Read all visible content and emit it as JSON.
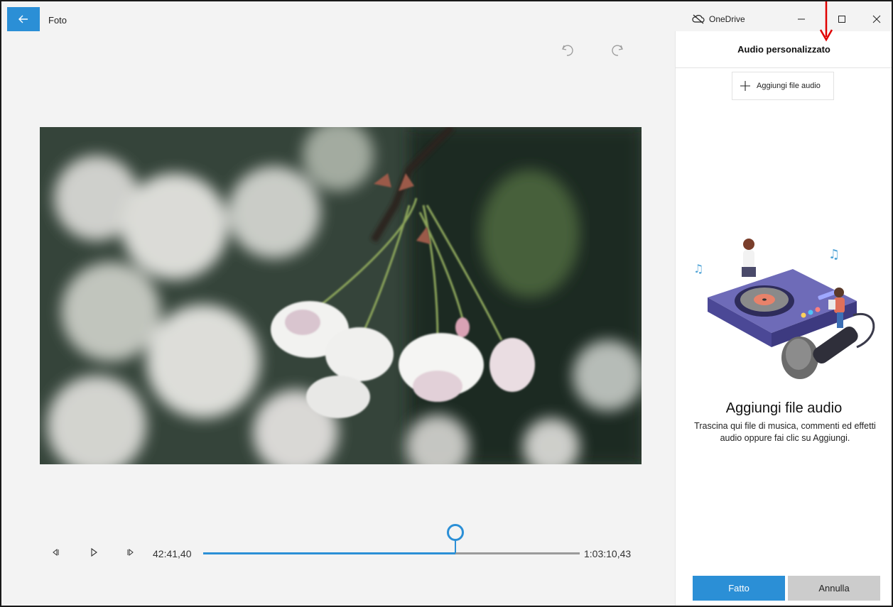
{
  "app": {
    "title": "Foto"
  },
  "window": {
    "onedrive_label": "OneDrive"
  },
  "player": {
    "current_time": "42:41,40",
    "total_time": "1:03:10,43",
    "progress": 0.67
  },
  "panel": {
    "title": "Audio personalizzato",
    "add_button_label": "Aggiungi file audio",
    "empty_title": "Aggiungi file audio",
    "empty_description": "Trascina qui file di musica, commenti ed effetti audio oppure fai clic su Aggiungi.",
    "done_label": "Fatto",
    "cancel_label": "Annulla"
  },
  "colors": {
    "accent": "#2b8fd6",
    "annotation": "#e00000"
  }
}
